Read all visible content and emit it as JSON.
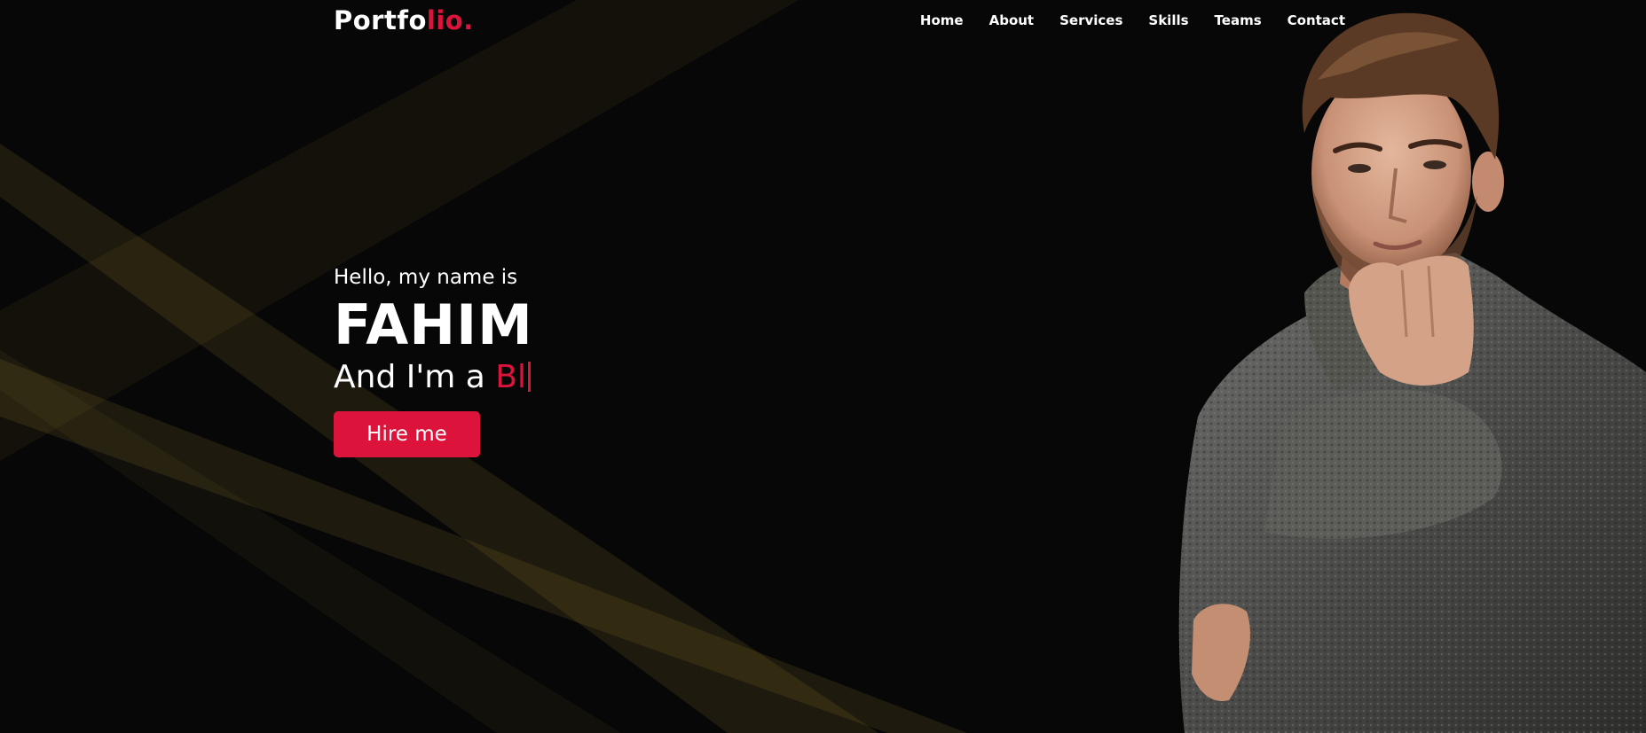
{
  "logo": {
    "primary": "Portfo",
    "accent": "lio."
  },
  "nav": [
    {
      "label": "Home"
    },
    {
      "label": "About"
    },
    {
      "label": "Services"
    },
    {
      "label": "Skills"
    },
    {
      "label": "Teams"
    },
    {
      "label": "Contact"
    }
  ],
  "hero": {
    "greeting": "Hello, my name is",
    "name": "FAHIM",
    "role_prefix": "And I'm a ",
    "role_typed": "Bl",
    "button_label": "Hire me"
  },
  "colors": {
    "background": "#070707",
    "accent": "#dc143c",
    "text": "#ffffff",
    "beam": "#e8c248"
  },
  "icons": {
    "portrait": "man-in-grey-sweater-portrait"
  }
}
